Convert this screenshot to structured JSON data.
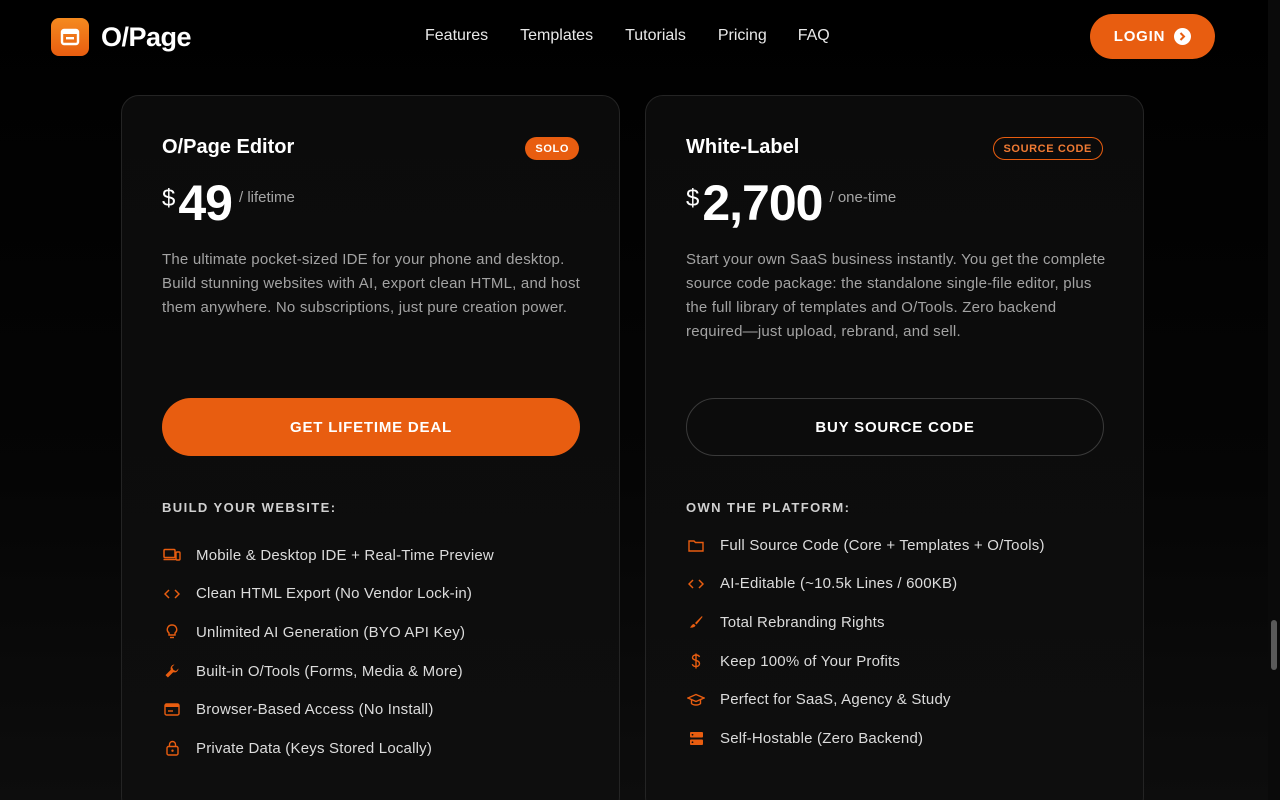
{
  "brand": {
    "name": "O/Page",
    "accent": "#e85d10"
  },
  "nav": {
    "items": [
      "Features",
      "Templates",
      "Tutorials",
      "Pricing",
      "FAQ"
    ]
  },
  "login": {
    "label": "LOGIN"
  },
  "plans": [
    {
      "title": "O/Page Editor",
      "badge": "SOLO",
      "currency": "$",
      "amount": "49",
      "period": "/ lifetime",
      "description": "The ultimate pocket-sized IDE for your phone and desktop. Build stunning websites with AI, export clean HTML, and host them anywhere. No subscriptions, just pure creation power.",
      "cta": "GET LIFETIME DEAL",
      "features_heading": "BUILD YOUR WEBSITE:",
      "features": [
        {
          "icon": "devices-icon",
          "label": "Mobile & Desktop IDE + Real-Time Preview"
        },
        {
          "icon": "code-icon",
          "label": "Clean HTML Export (No Vendor Lock-in)"
        },
        {
          "icon": "lightbulb-icon",
          "label": "Unlimited AI Generation (BYO API Key)"
        },
        {
          "icon": "wrench-icon",
          "label": "Built-in O/Tools (Forms, Media & More)"
        },
        {
          "icon": "browser-icon",
          "label": "Browser-Based Access (No Install)"
        },
        {
          "icon": "lock-icon",
          "label": "Private Data (Keys Stored Locally)"
        }
      ]
    },
    {
      "title": "White-Label",
      "badge": "SOURCE CODE",
      "currency": "$",
      "amount": "2,700",
      "period": "/ one-time",
      "description": "Start your own SaaS business instantly. You get the complete source code package: the standalone single-file editor, plus the full library of templates and O/Tools. Zero backend required—just upload, rebrand, and sell.",
      "cta": "BUY SOURCE CODE",
      "features_heading": "OWN THE PLATFORM:",
      "features": [
        {
          "icon": "folder-icon",
          "label": "Full Source Code (Core + Templates + O/Tools)"
        },
        {
          "icon": "code-icon",
          "label": "AI-Editable (~10.5k Lines / 600KB)"
        },
        {
          "icon": "brush-icon",
          "label": "Total Rebranding Rights"
        },
        {
          "icon": "dollar-icon",
          "label": "Keep 100% of Your Profits"
        },
        {
          "icon": "graduation-cap-icon",
          "label": "Perfect for SaaS, Agency & Study"
        },
        {
          "icon": "server-icon",
          "label": "Self-Hostable (Zero Backend)"
        }
      ]
    }
  ]
}
